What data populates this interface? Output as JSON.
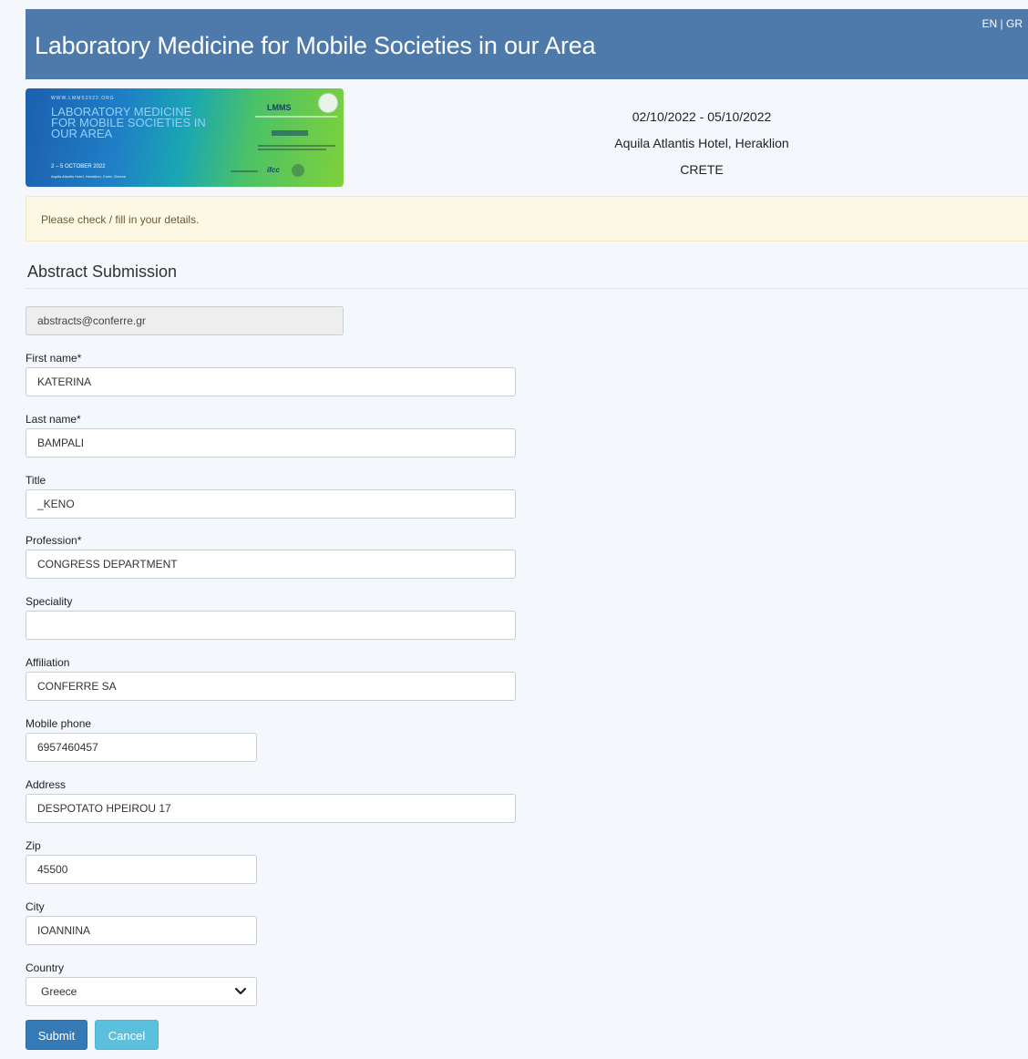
{
  "header": {
    "title": "Laboratory Medicine for Mobile Societies in our Area",
    "lang_en": "EN",
    "lang_sep": " | ",
    "lang_gr": "GR"
  },
  "banner": {
    "small_text": "WWW.LMMS2022.ORG",
    "title": "LABORATORY MEDICINE FOR MOBILE SOCIETIES IN OUR AREA",
    "dates": "2 – 5 OCTOBER 2022",
    "location": "Aquila Atlantis Hotel, Heraklion, Crete, Greece",
    "logo_text": "LMMS",
    "ifcc_text": "ifcc"
  },
  "event": {
    "dates": "02/10/2022 - 05/10/2022",
    "venue": "Aquila Atlantis Hotel, Heraklion",
    "place": "CRETE"
  },
  "alert": {
    "text": "Please check / fill in your details."
  },
  "section": {
    "title": "Abstract Submission"
  },
  "form": {
    "email": "abstracts@conferre.gr",
    "first_name": {
      "label": "First name*",
      "value": "KATERINA"
    },
    "last_name": {
      "label": "Last name*",
      "value": "BAMPALI"
    },
    "title": {
      "label": "Title",
      "value": "_KENO"
    },
    "profession": {
      "label": "Profession*",
      "value": "CONGRESS DEPARTMENT"
    },
    "speciality": {
      "label": "Speciality",
      "value": ""
    },
    "affiliation": {
      "label": "Affiliation",
      "value": "CONFERRE SA"
    },
    "mobile": {
      "label": "Mobile phone",
      "value": "6957460457"
    },
    "address": {
      "label": "Address",
      "value": "DESPOTATO HPEIROU 17"
    },
    "zip": {
      "label": "Zip",
      "value": "45500"
    },
    "city": {
      "label": "City",
      "value": "IOANNINA"
    },
    "country": {
      "label": "Country",
      "value": "Greece"
    }
  },
  "buttons": {
    "submit": "Submit",
    "cancel": "Cancel"
  },
  "colors": {
    "header_bg": "#4e7aab",
    "submit_bg": "#337ab7",
    "cancel_bg": "#5bc0de",
    "alert_bg": "#fcf8e3"
  }
}
